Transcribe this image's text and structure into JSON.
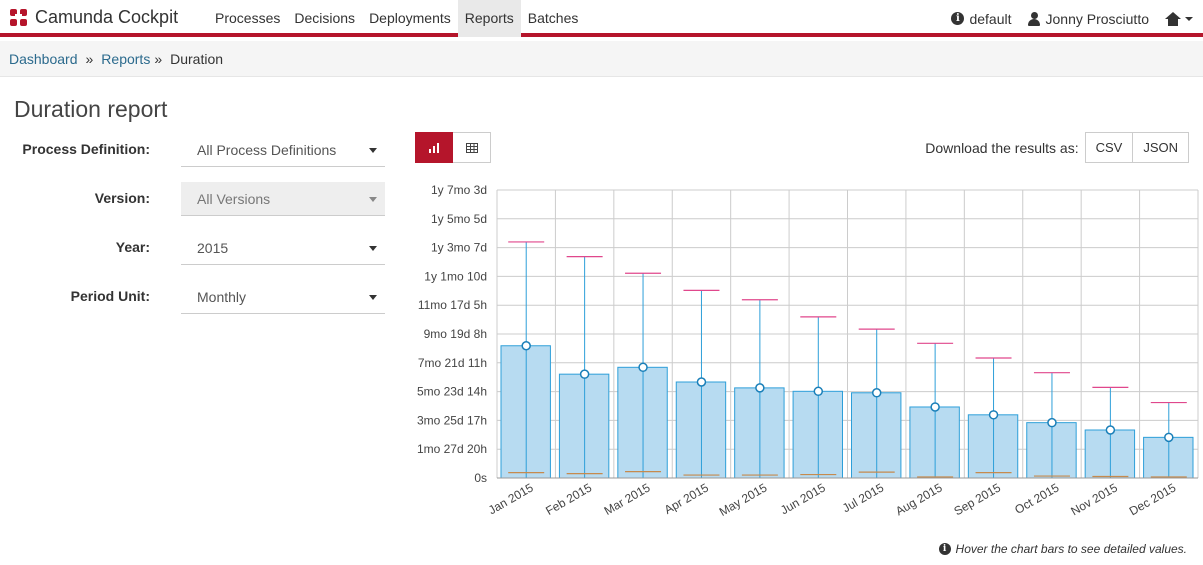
{
  "navbar": {
    "brand": "Camunda Cockpit",
    "items": [
      {
        "label": "Processes",
        "active": false
      },
      {
        "label": "Decisions",
        "active": false
      },
      {
        "label": "Deployments",
        "active": false
      },
      {
        "label": "Reports",
        "active": true
      },
      {
        "label": "Batches",
        "active": false
      }
    ],
    "engine": "default",
    "user": "Jonny Prosciutto",
    "home_icon": "home-icon"
  },
  "breadcrumb": {
    "items": [
      "Dashboard",
      "Reports"
    ],
    "separator": "»",
    "current": "Duration"
  },
  "page_title": "Duration report",
  "form": {
    "process_definition": {
      "label": "Process Definition:",
      "value": "All Process Definitions"
    },
    "version": {
      "label": "Version:",
      "value": "All Versions",
      "disabled": true
    },
    "year": {
      "label": "Year:",
      "value": "2015"
    },
    "period_unit": {
      "label": "Period Unit:",
      "value": "Monthly"
    }
  },
  "view_toggle": {
    "active": "chart",
    "chart_icon": "bar-chart-icon",
    "table_icon": "table-icon"
  },
  "download": {
    "label": "Download the results as:",
    "csv": "CSV",
    "json": "JSON"
  },
  "hint": "Hover the chart bars to see detailed values.",
  "colors": {
    "accent": "#b5152b",
    "bar_fill": "#b7dbf1",
    "bar_stroke": "#2d9fd9",
    "max_line": "#e0478c",
    "min_line": "#c68a4d"
  },
  "chart_data": {
    "type": "bar",
    "categories": [
      "Jan 2015",
      "Feb 2015",
      "Mar 2015",
      "Apr 2015",
      "May 2015",
      "Jun 2015",
      "Jul 2015",
      "Aug 2015",
      "Sep 2015",
      "Oct 2015",
      "Nov 2015",
      "Dec 2015"
    ],
    "y_ticks": [
      "0s",
      "1mo 27d 20h",
      "3mo 25d 17h",
      "5mo 23d 14h",
      "7mo 21d 11h",
      "9mo 19d 8h",
      "11mo 17d 5h",
      "1y 1mo 10d",
      "1y 3mo 7d",
      "1y 5mo 5d",
      "1y 7mo 3d"
    ],
    "y_unit": "days",
    "ylim": [
      0,
      588
    ],
    "series": [
      {
        "name": "avg",
        "values": [
          270,
          212,
          226,
          196,
          184,
          177,
          174,
          145,
          129,
          113,
          98,
          83
        ]
      },
      {
        "name": "max",
        "values": [
          482,
          452,
          418,
          383,
          364,
          329,
          304,
          275,
          245,
          215,
          185,
          154
        ]
      },
      {
        "name": "min",
        "values": [
          11,
          9,
          13,
          6,
          6,
          7,
          12,
          2,
          11,
          4,
          3,
          2
        ]
      }
    ],
    "grid": true
  }
}
